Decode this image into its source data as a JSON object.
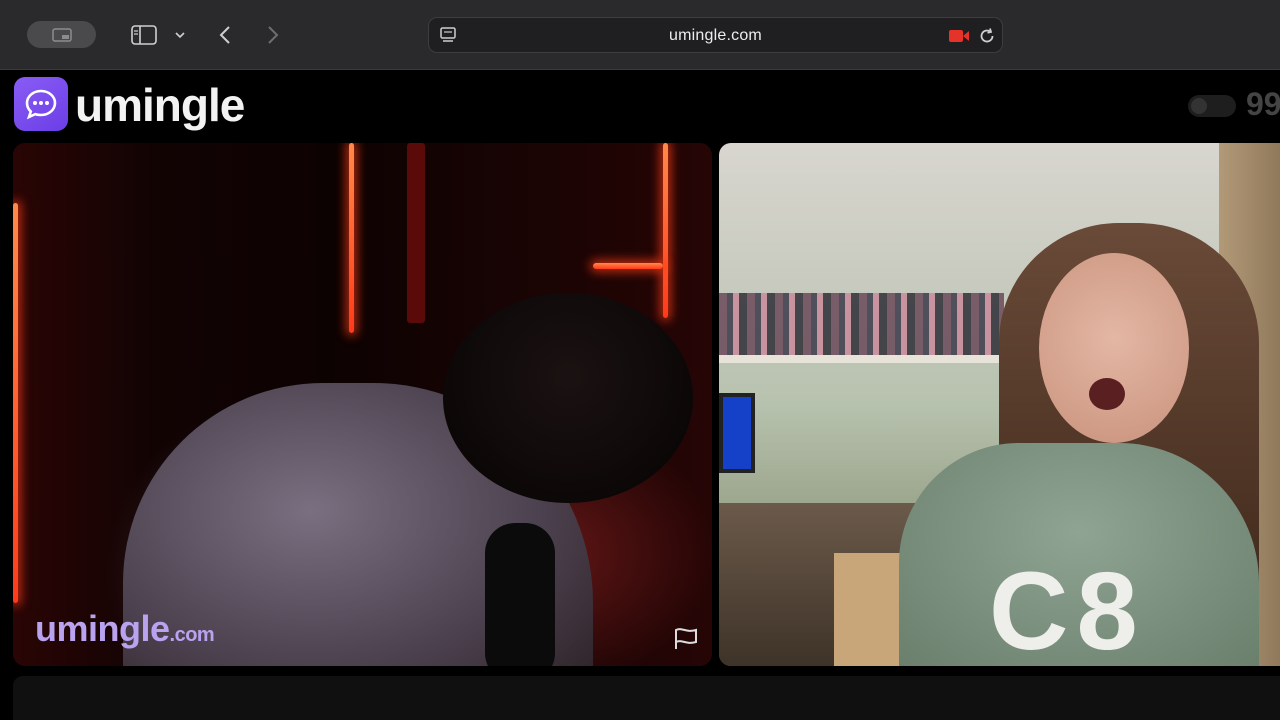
{
  "browser": {
    "url": "umingle.com",
    "accent_recording": "#e5332a"
  },
  "site": {
    "logo_text": "umingle",
    "online_count": "99",
    "brand_color": "#7a4bf0"
  },
  "video": {
    "watermark_main": "umingle",
    "watermark_suffix": ".com"
  },
  "sweater_print": "C8"
}
